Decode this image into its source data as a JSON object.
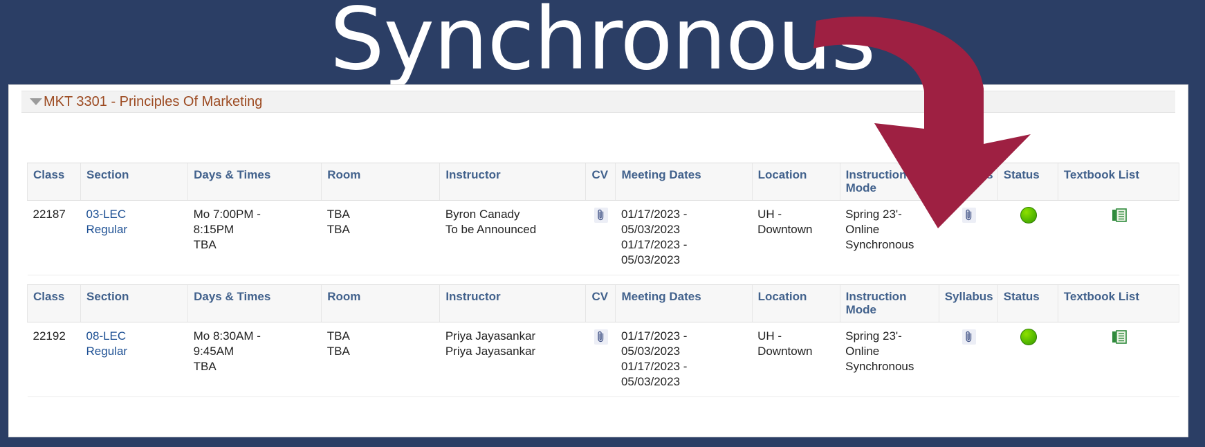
{
  "banner": {
    "title": "Synchronous",
    "background_color": "#2b3e65",
    "title_color": "#ffffff"
  },
  "arrow": {
    "name": "annotation-arrow",
    "color": "#9e2042",
    "points_to": "Syllabus"
  },
  "course": {
    "expanded": true,
    "title": "MKT 3301 - Principles Of Marketing",
    "title_color": "#9c4a21"
  },
  "columns": [
    "Class",
    "Section",
    "Days & Times",
    "Room",
    "Instructor",
    "CV",
    "Meeting Dates",
    "Location",
    "Instruction Mode",
    "Syllabus",
    "Status",
    "Textbook List"
  ],
  "sections": [
    {
      "class": "22187",
      "section": "03-LEC\nRegular",
      "section_line1": "03-LEC",
      "section_line2": "Regular",
      "days_times": "Mo 7:00PM - 8:15PM\nTBA",
      "days_line1": "Mo 7:00PM -",
      "days_line2": "8:15PM",
      "days_line3": "TBA",
      "room_line1": "TBA",
      "room_line2": "TBA",
      "instructor_line1": "Byron Canady",
      "instructor_line2": "To be Announced",
      "cv_icon": "paperclip-icon",
      "meeting_dates_line1": "01/17/2023 -",
      "meeting_dates_line2": "05/03/2023",
      "meeting_dates_line3": "01/17/2023 -",
      "meeting_dates_line4": "05/03/2023",
      "location_line1": "UH -",
      "location_line2": "Downtown",
      "instruction_mode_line1": "Spring 23'-",
      "instruction_mode_line2": "Online",
      "instruction_mode_line3": "Synchronous",
      "syllabus_icon": "paperclip-icon",
      "status_icon": "green-status-dot",
      "status_value": "Open",
      "textbook_icon": "textbook-list-icon"
    },
    {
      "class": "22192",
      "section": "08-LEC\nRegular",
      "section_line1": "08-LEC",
      "section_line2": "Regular",
      "days_times": "Mo 8:30AM - 9:45AM\nTBA",
      "days_line1": "Mo 8:30AM -",
      "days_line2": "9:45AM",
      "days_line3": "TBA",
      "room_line1": "TBA",
      "room_line2": "TBA",
      "instructor_line1": "Priya Jayasankar",
      "instructor_line2": "Priya Jayasankar",
      "cv_icon": "paperclip-icon",
      "meeting_dates_line1": "01/17/2023 -",
      "meeting_dates_line2": "05/03/2023",
      "meeting_dates_line3": "01/17/2023 -",
      "meeting_dates_line4": "05/03/2023",
      "location_line1": "UH -",
      "location_line2": "Downtown",
      "instruction_mode_line1": "Spring 23'-",
      "instruction_mode_line2": "Online",
      "instruction_mode_line3": "Synchronous",
      "syllabus_icon": "paperclip-icon",
      "status_icon": "green-status-dot",
      "status_value": "Open",
      "textbook_icon": "textbook-list-icon"
    }
  ]
}
